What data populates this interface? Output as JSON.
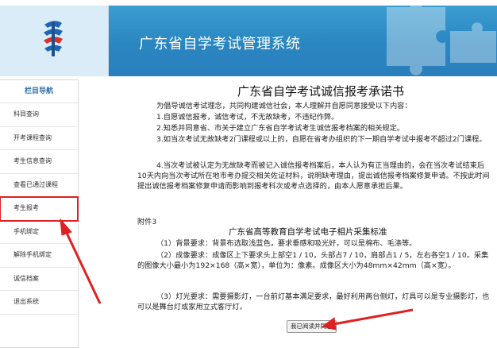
{
  "header": {
    "system_title": "广东省自学考试管理系统"
  },
  "sidebar": {
    "title": "栏目导航",
    "items": [
      {
        "label": "科目查询"
      },
      {
        "label": "开考课程查询"
      },
      {
        "label": "考生信息查询"
      },
      {
        "label": "查看已通过课程"
      },
      {
        "label": "考生报考",
        "highlighted": true
      },
      {
        "label": "手机绑定"
      },
      {
        "label": "解除手机绑定"
      },
      {
        "label": "诚信档案"
      },
      {
        "label": "退出系统"
      }
    ]
  },
  "main": {
    "doc_title": "广东省自学考试诚信报考承诺书",
    "paragraphs": [
      "为倡导诚信考试理念，共同构建诚信社会，本人理解并自愿同意接受以下内容：",
      "1.自愿诚信报考，诚信考试，不无故缺考，不违纪作弊。",
      "2.知悉并同意省、市关于建立广东省自学考试考生诚信报考档案的相关规定。",
      "3.如当次考试无故缺考2门课程或以上的，自愿在省考办组织的下一期自学考试中报考不超过2门课程。",
      "4.当次考试被认定为无故缺考而被记入诚信报考档案后，本人认为有正当理由的，会在当次考试结束后10天内向当次考试所在地市考办提交相关佐证材料，说明缺考理由，提出诚信报考档案修复申请。不按此时间提出诚信报考档案修复申请而影响到报考科次或考点选择的，由本人愿意承担后果。"
    ],
    "annex_label": "附件3",
    "photo_title": "广东省高等教育自学考试电子相片采集标准",
    "photo_paragraphs": [
      "（1）背景要求：背景布选取浅蓝色，要求垂感和吸光好，可以是棉布、毛涤等。",
      "（2）成像要求：成像区上下要求头上部空1 / 10，头部占7 / 10，肩部占1 / 5，左右各空1 / 10。采集的图像大小最小为192×168（高×宽），单位为：像素。成像区大小为48mm×42mm（高×宽）。",
      "（3）灯光要求：需要摄影灯，一台前灯基本满足要求，最好利用两台侧灯，灯具可以是专业摄影灯，也可以是舞台灯或家用立式客厅灯。"
    ],
    "agree_button": "我已阅读并同意"
  },
  "colors": {
    "banner": "#2a86c1",
    "sidebar_title": "#2d6fa8",
    "annotation": "#e02020"
  }
}
